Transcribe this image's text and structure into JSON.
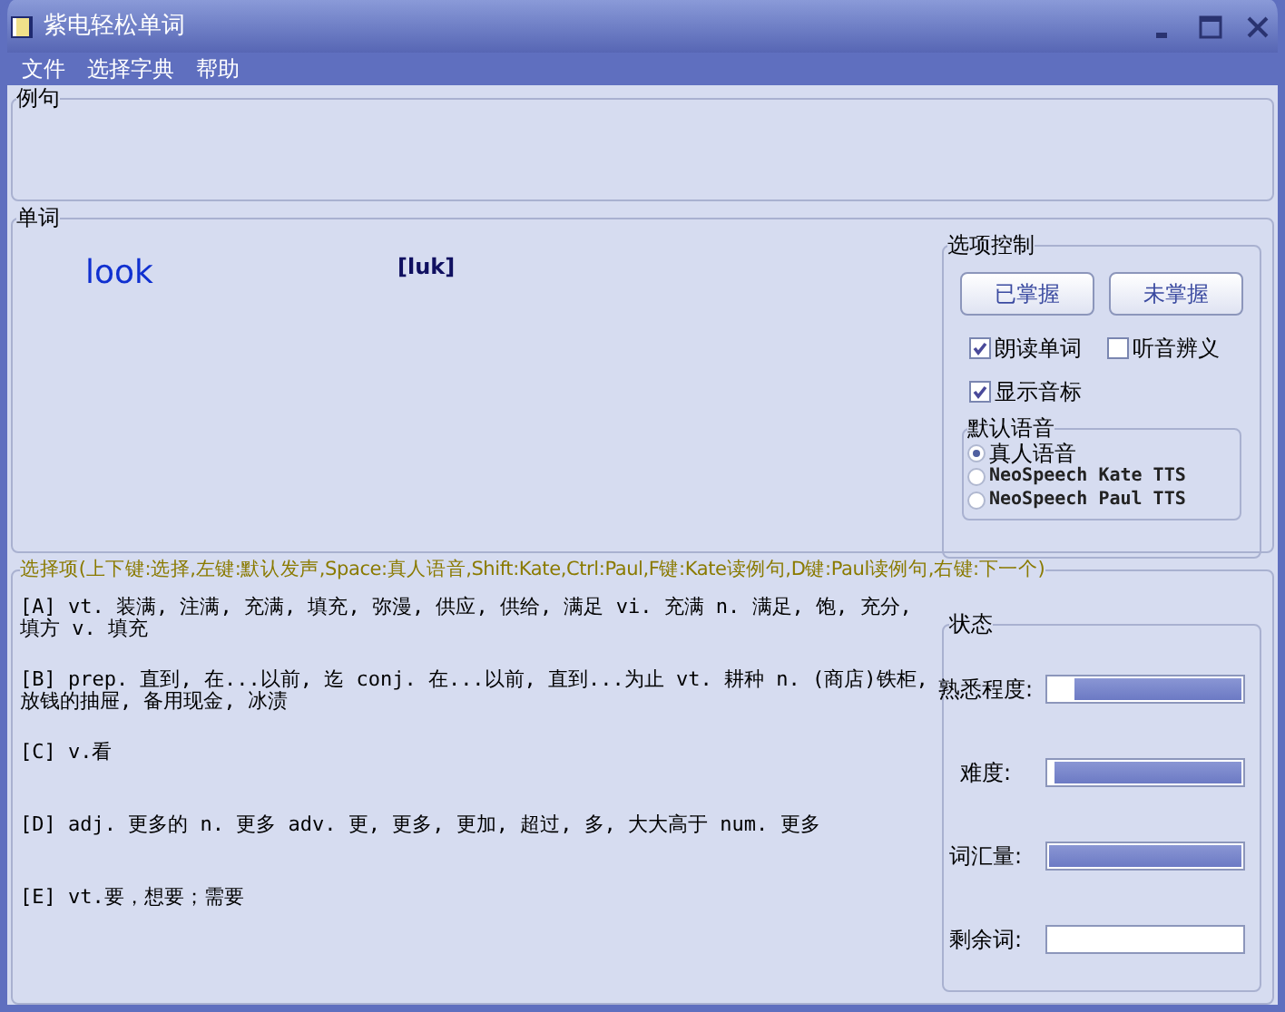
{
  "window": {
    "title": "紫电轻松单词"
  },
  "menu": [
    "文件",
    "选择字典",
    "帮助"
  ],
  "example_group": {
    "label": "例句"
  },
  "word_group": {
    "label": "单词",
    "word": "look",
    "phonetic": "[luk]"
  },
  "options": {
    "label": "选项控制",
    "buttons": [
      "已掌握",
      "未掌握"
    ],
    "checkboxes": [
      {
        "label": "朗读单词",
        "checked": true
      },
      {
        "label": "听音辨义",
        "checked": false
      },
      {
        "label": "显示音标",
        "checked": true
      }
    ],
    "voice": {
      "label": "默认语音",
      "radios": [
        {
          "label": "真人语音",
          "selected": true
        },
        {
          "label": "NeoSpeech Kate TTS",
          "selected": false
        },
        {
          "label": "NeoSpeech Paul TTS",
          "selected": false
        }
      ]
    }
  },
  "choices": {
    "label": "选择项(上下键:选择,左键:默认发声,Space:真人语音,Shift:Kate,Ctrl:Paul,F键:Kate读例句,D键:Paul读例句,右键:下一个)",
    "items": [
      "[A]  vt. 装满, 注满, 充满, 填充, 弥漫, 供应, 供给, 满足 vi. 充满 n. 满足, 饱, 充分, 填方 v. 填充",
      "[B]  prep. 直到, 在...以前, 迄 conj. 在...以前, 直到...为止 vt. 耕种 n. (商店)铁柜, 放钱的抽屉, 备用现金, 冰渍",
      "[C]  v.看",
      "[D]  adj. 更多的 n. 更多 adv. 更, 更多, 更加, 超过, 多, 大大高于 num. 更多",
      "[E]  vt.要，想要；需要"
    ]
  },
  "status": {
    "label": "状态",
    "meters": [
      {
        "label": "熟悉程度:",
        "level": 0.87
      },
      {
        "label": "难度:",
        "level": 0.97
      },
      {
        "label": "词汇量:",
        "level": 1
      },
      {
        "label": "剩余词:",
        "level": 0
      }
    ]
  }
}
